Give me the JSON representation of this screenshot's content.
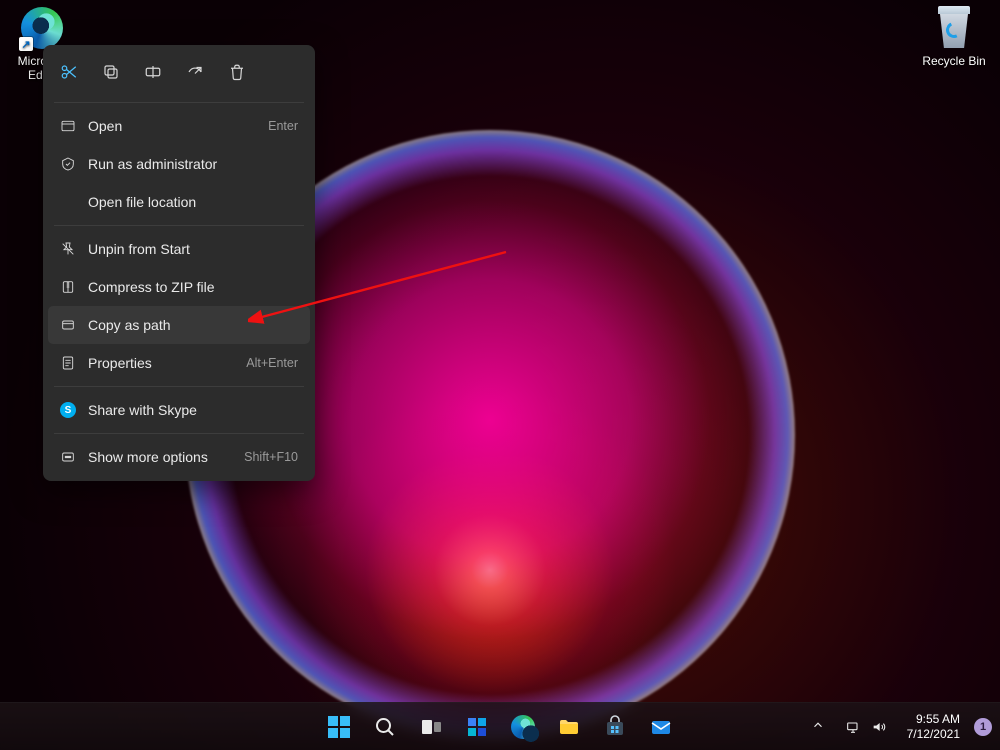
{
  "desktop_icons": {
    "edge_label": "Microsoft Edge",
    "recycle_label": "Recycle Bin"
  },
  "context_menu": {
    "top_actions": {
      "cut": "Cut",
      "copy": "Copy",
      "rename": "Rename",
      "share": "Share",
      "delete": "Delete"
    },
    "items": [
      {
        "icon": "open",
        "label": "Open",
        "accel": "Enter"
      },
      {
        "icon": "admin",
        "label": "Run as administrator",
        "accel": ""
      },
      {
        "icon": "",
        "label": "Open file location",
        "accel": ""
      },
      {
        "sep": true
      },
      {
        "icon": "unpin",
        "label": "Unpin from Start",
        "accel": ""
      },
      {
        "icon": "zip",
        "label": "Compress to ZIP file",
        "accel": ""
      },
      {
        "icon": "copypath",
        "label": "Copy as path",
        "accel": "",
        "highlight": true
      },
      {
        "icon": "props",
        "label": "Properties",
        "accel": "Alt+Enter"
      },
      {
        "sep": true
      },
      {
        "icon": "skype",
        "label": "Share with Skype",
        "accel": ""
      },
      {
        "sep": true
      },
      {
        "icon": "more",
        "label": "Show more options",
        "accel": "Shift+F10"
      }
    ]
  },
  "taskbar": {
    "apps": [
      "start",
      "search",
      "taskview",
      "widgets",
      "edge",
      "explorer",
      "store",
      "mail"
    ],
    "tray": {
      "network": "network-icon",
      "volume": "volume-icon"
    },
    "clock": {
      "time": "9:55 AM",
      "date": "7/12/2021"
    },
    "notification_count": "1"
  },
  "annotation": {
    "purpose": "arrow pointing to Copy as path"
  }
}
